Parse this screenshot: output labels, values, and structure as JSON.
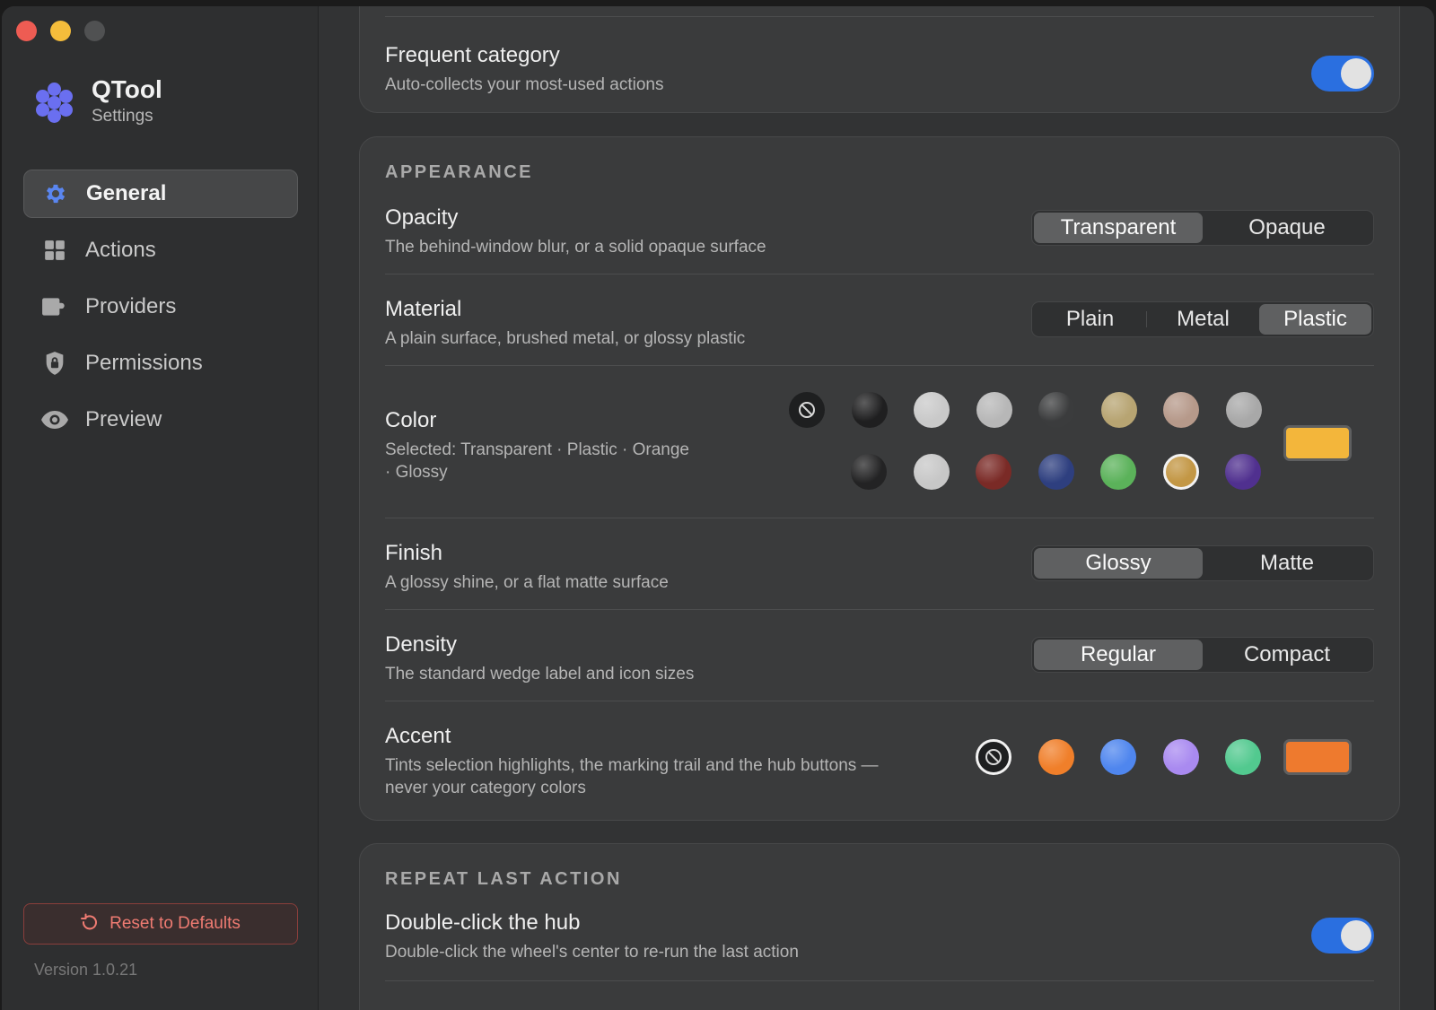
{
  "app": {
    "name": "QTool",
    "subtitle": "Settings"
  },
  "sidebar": {
    "items": [
      {
        "label": "General",
        "icon": "gear-icon",
        "active": true
      },
      {
        "label": "Actions",
        "icon": "grid-icon",
        "active": false
      },
      {
        "label": "Providers",
        "icon": "plugin-icon",
        "active": false
      },
      {
        "label": "Permissions",
        "icon": "lock-shield-icon",
        "active": false
      },
      {
        "label": "Preview",
        "icon": "eye-icon",
        "active": false
      }
    ],
    "reset_label": "Reset to Defaults",
    "version": "Version 1.0.21"
  },
  "frequent": {
    "title": "Frequent category",
    "desc": "Auto-collects your most-used actions",
    "enabled": true
  },
  "appearance": {
    "section": "APPEARANCE",
    "opacity": {
      "title": "Opacity",
      "desc": "The behind-window blur, or a solid opaque surface",
      "options": [
        "Transparent",
        "Opaque"
      ],
      "selected": "Transparent"
    },
    "material": {
      "title": "Material",
      "desc": "A plain surface, brushed metal, or glossy plastic",
      "options": [
        "Plain",
        "Metal",
        "Plastic"
      ],
      "selected": "Plastic"
    },
    "color": {
      "title": "Color",
      "desc_line1": "Selected: Transparent · Plastic · Orange",
      "desc_line2": "· Glossy",
      "row1": [
        "none",
        "#1f1f20",
        "#c9c9c9",
        "#b7b7b7",
        "#3b3c3d",
        "#b7a472",
        "#b6998a",
        "#a8a8a8"
      ],
      "row2": [
        "#232324",
        "#c7c7c7",
        "#7a2a26",
        "#2e3f7f",
        "#5bb25a",
        "#c39745",
        "#50308f"
      ],
      "selected": "#c39745",
      "preview": "#f3b63b"
    },
    "finish": {
      "title": "Finish",
      "desc": "A glossy shine, or a flat matte surface",
      "options": [
        "Glossy",
        "Matte"
      ],
      "selected": "Glossy"
    },
    "density": {
      "title": "Density",
      "desc": "The standard wedge label and icon sizes",
      "options": [
        "Regular",
        "Compact"
      ],
      "selected": "Regular"
    },
    "accent": {
      "title": "Accent",
      "desc_line1": "Tints selection highlights, the marking trail and the hub buttons —",
      "desc_line2": "never your category colors",
      "swatches": [
        "none",
        "#f07f2a",
        "#4f86ee",
        "#a98af0",
        "#52c98f"
      ],
      "selected": "none",
      "preview": "#ee7a2e"
    }
  },
  "repeat": {
    "section": "REPEAT LAST ACTION",
    "title": "Double-click the hub",
    "desc": "Double-click the wheel's center to re-run the last action",
    "enabled": true
  }
}
